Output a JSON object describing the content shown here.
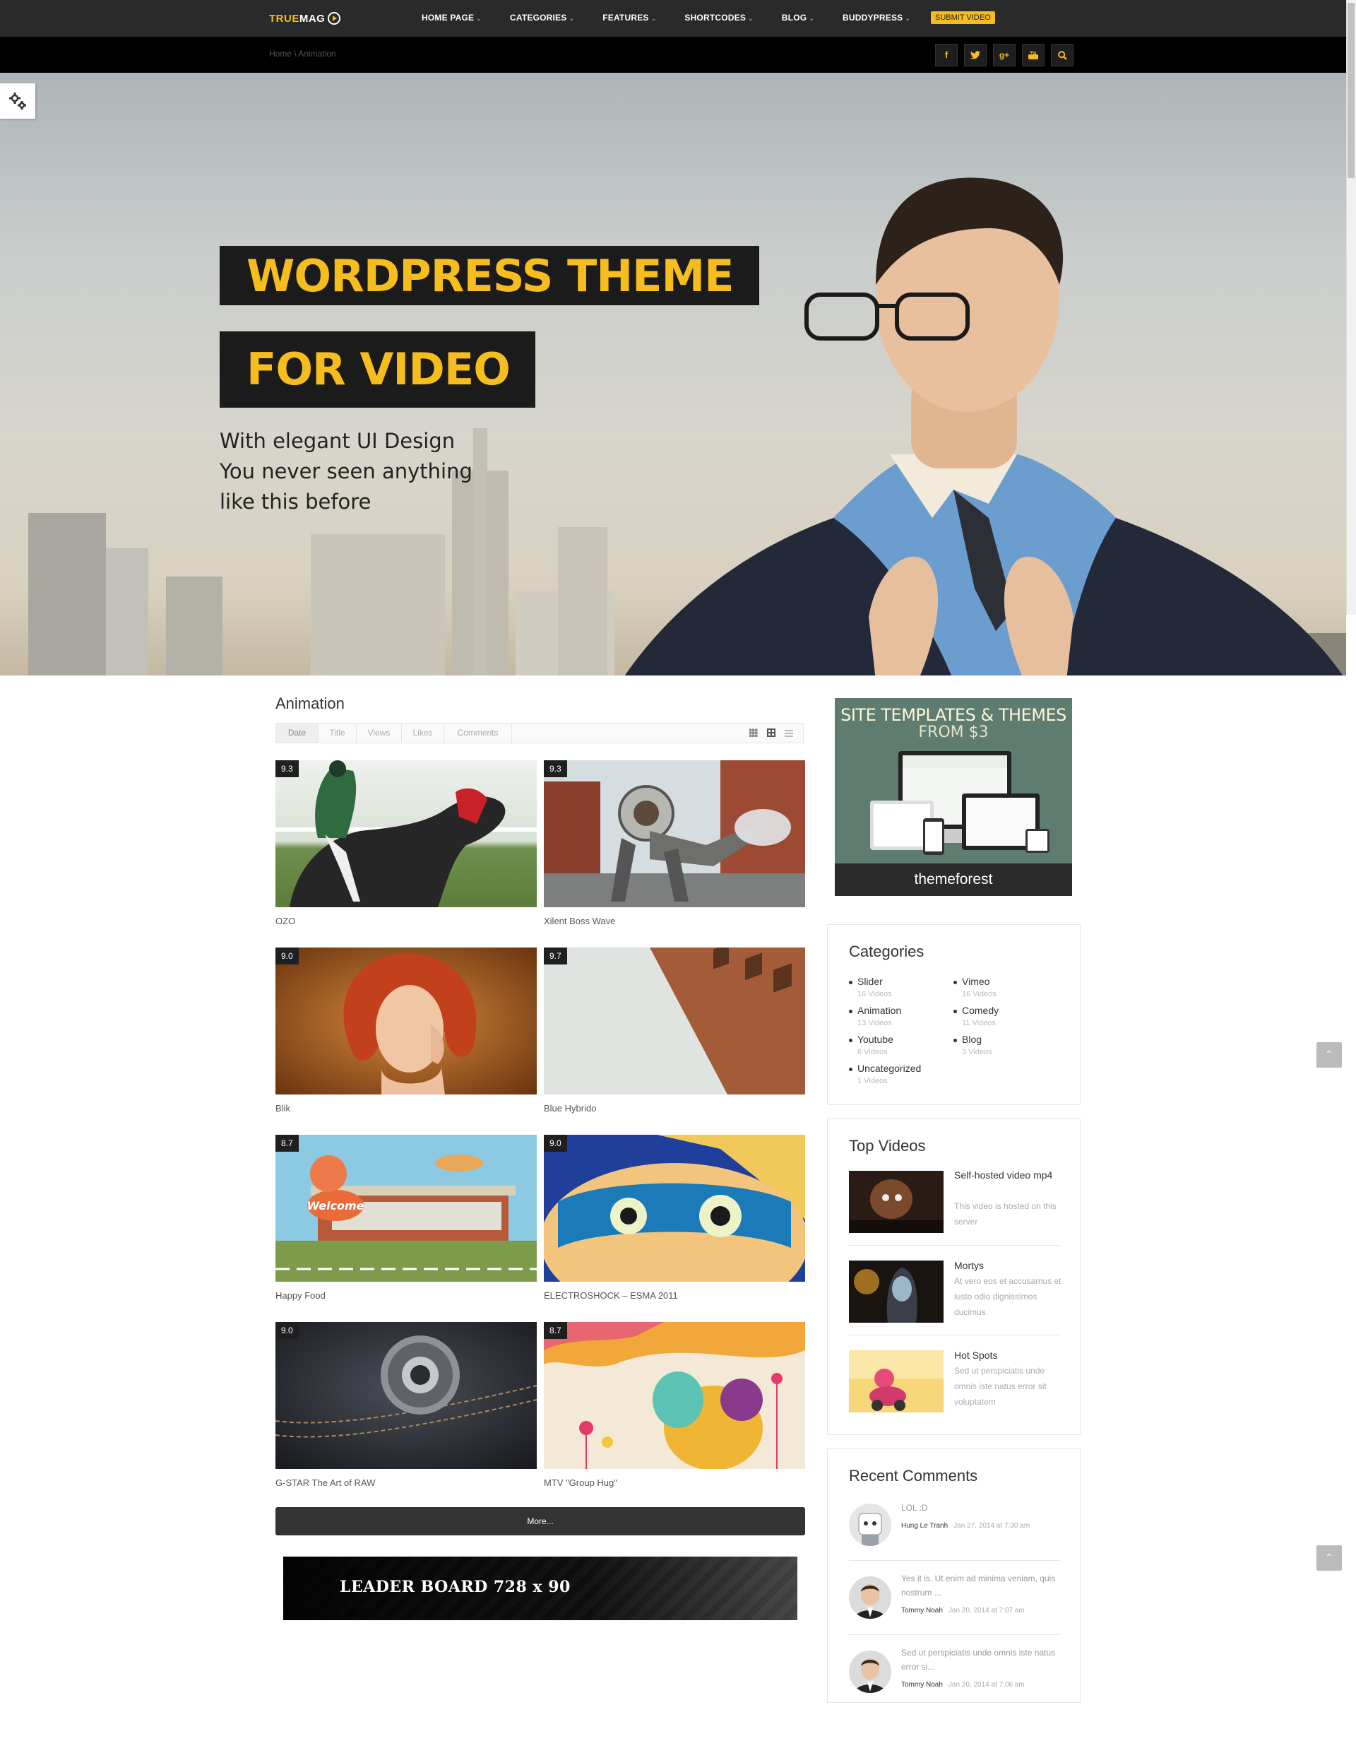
{
  "site": {
    "logo_part1": "TRUE",
    "logo_part2": "MAG",
    "menu": [
      "HOME PAGE",
      "CATEGORIES",
      "FEATURES",
      "SHORTCODES",
      "BLOG",
      "BUDDYPRESS"
    ],
    "submit_video": "SUBMIT VIDEO",
    "breadcrumb": "Home \\ Animation",
    "social": [
      "f",
      "t",
      "g+",
      "yt",
      "search"
    ]
  },
  "hero": {
    "line1": "WORDPRESS THEME",
    "line2": "FOR VIDEO",
    "sub": [
      "With elegant UI Design",
      "You never seen anything",
      "like this before"
    ]
  },
  "main": {
    "title": "Animation",
    "sort_tabs": [
      "Date",
      "Title",
      "Views",
      "Likes",
      "Comments"
    ],
    "active_sort": "Date",
    "videos": [
      {
        "title": "OZO",
        "rating": "9.3"
      },
      {
        "title": "Xilent Boss Wave",
        "rating": "9.3"
      },
      {
        "title": "Blik",
        "rating": "9.0"
      },
      {
        "title": "Blue Hybrido",
        "rating": "9.7"
      },
      {
        "title": "Happy Food",
        "rating": "8.7"
      },
      {
        "title": "ELECTROSHOCK – ESMA 2011",
        "rating": "9.0"
      },
      {
        "title": "G-STAR The Art of RAW",
        "rating": "9.0"
      },
      {
        "title": "MTV \"Group Hug\"",
        "rating": "8.7"
      }
    ],
    "more": "More...",
    "leaderboard": "LEADER BOARD 728 x 90",
    "welcome_sign": "Welcome"
  },
  "sidebar": {
    "ad": {
      "title": "SITE TEMPLATES & THEMES",
      "sub": "FROM $3",
      "brand": "themeforest"
    },
    "categories": {
      "title": "Categories",
      "items": [
        {
          "name": "Slider",
          "count": "16 Videos"
        },
        {
          "name": "Vimeo",
          "count": "16 Videos"
        },
        {
          "name": "Animation",
          "count": "13 Videos"
        },
        {
          "name": "Comedy",
          "count": "11 Videos"
        },
        {
          "name": "Youtube",
          "count": "6 Videos"
        },
        {
          "name": "Blog",
          "count": "3 Videos"
        },
        {
          "name": "Uncategorized",
          "count": "1 Videos"
        }
      ]
    },
    "top_videos": {
      "title": "Top Videos",
      "items": [
        {
          "title": "Self-hosted video mp4",
          "desc": "This video is hosted on this server"
        },
        {
          "title": "Mortys",
          "desc": "At vero eos et accusamus et iusto odio dignissimos ducimus"
        },
        {
          "title": "Hot Spots",
          "desc": "Sed ut perspiciatis unde omnis iste natus error sit voluptatem"
        }
      ]
    },
    "recent_comments": {
      "title": "Recent Comments",
      "items": [
        {
          "text": "LOL :D",
          "author": "Hung Le Tranh",
          "date": "Jan 27, 2014 at 7:30 am"
        },
        {
          "text": "Yes it is. Ut enim ad minima veniam, quis nostrum ...",
          "author": "Tommy Noah",
          "date": "Jan 20, 2014 at 7:07 am"
        },
        {
          "text": "Sed ut perspiciatis unde omnis iste natus error si...",
          "author": "Tommy Noah",
          "date": "Jan 20, 2014 at 7:06 am"
        }
      ]
    }
  },
  "colors": {
    "accent": "#f6bd1e",
    "nav_bg": "#2a2a2a",
    "subbar_bg": "#000000"
  }
}
